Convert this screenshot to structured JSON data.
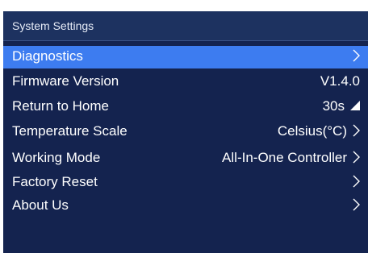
{
  "header": {
    "title": "System Settings"
  },
  "menu": {
    "items": [
      {
        "label": "Diagnostics",
        "value": "",
        "indicator": "chevron-right-icon",
        "selected": true
      },
      {
        "label": "Firmware Version",
        "value": "V1.4.0",
        "indicator": "",
        "selected": false
      },
      {
        "label": "Return to Home",
        "value": "30s",
        "indicator": "corner-triangle-icon",
        "selected": false
      },
      {
        "label": "Temperature Scale",
        "value": "Celsius(°C)",
        "indicator": "chevron-right-icon",
        "selected": false
      },
      {
        "label": "Working Mode",
        "value": "All-In-One Controller",
        "indicator": "chevron-right-icon",
        "selected": false
      },
      {
        "label": "Factory Reset",
        "value": "",
        "indicator": "chevron-right-icon",
        "selected": false
      },
      {
        "label": "About Us",
        "value": "",
        "indicator": "chevron-right-icon",
        "selected": false
      }
    ]
  },
  "colors": {
    "background": "#14234f",
    "title_bar": "#1d3260",
    "selected_row": "#3d7cf0",
    "text": "#ffffff"
  }
}
